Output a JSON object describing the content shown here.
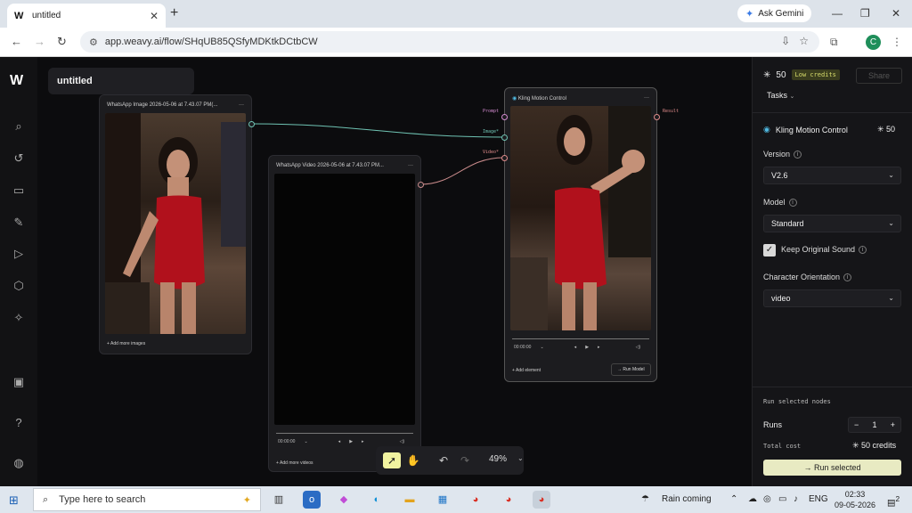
{
  "browser": {
    "tab_title": "untitled",
    "tab_favicon": "W",
    "new_tab": "+",
    "gemini": "Ask Gemini",
    "url": "app.weavy.ai/flow/SHqUB85QSfyMDKtkDCtbCW",
    "profile_initial": "C"
  },
  "sidebar": {
    "logo": "W",
    "icons": [
      "search-icon",
      "history-icon",
      "briefcase-icon",
      "image-edit-icon",
      "video-icon",
      "cube-icon",
      "sparkle-icon",
      "gallery-icon",
      "help-icon",
      "discord-icon"
    ]
  },
  "canvas": {
    "title": "untitled",
    "image_node": {
      "header": "WhatsApp Image 2026-05-06 at 7.43.07 PM(...",
      "menu": "···",
      "footer": "+ Add more images"
    },
    "video_node": {
      "header": "WhatsApp Video 2026-05-06 at 7.43.07 PM...",
      "menu": "···",
      "time": "00:00:00",
      "footer": "+ Add more videos"
    },
    "kling_node": {
      "header": "Kling Motion Control",
      "menu": "···",
      "ports": {
        "prompt": "Prompt",
        "image": "Image*",
        "video": "Video*",
        "result": "Result"
      },
      "time": "00:00:00",
      "add_element": "+ Add element",
      "run_model": "→ Run Model"
    }
  },
  "toolbar": {
    "zoom": "49%"
  },
  "panel": {
    "credits": "50",
    "low_credits": "Low credits",
    "share": "Share",
    "tasks": "Tasks",
    "node_name": "Kling Motion Control",
    "node_cost": "50",
    "version_label": "Version",
    "version_value": "V2.6",
    "model_label": "Model",
    "model_value": "Standard",
    "keep_sound": "Keep Original Sound",
    "orientation_label": "Character Orientation",
    "orientation_value": "video",
    "run_selected_label": "Run selected nodes",
    "runs_label": "Runs",
    "runs_value": "1",
    "total_cost_label": "Total cost",
    "total_cost_value": "50 credits",
    "run_button": "Run selected"
  },
  "taskbar": {
    "search_placeholder": "Type here to search",
    "weather": "Rain coming",
    "lang": "ENG",
    "time": "02:33",
    "date": "09-05-2026",
    "notif_count": "2"
  }
}
